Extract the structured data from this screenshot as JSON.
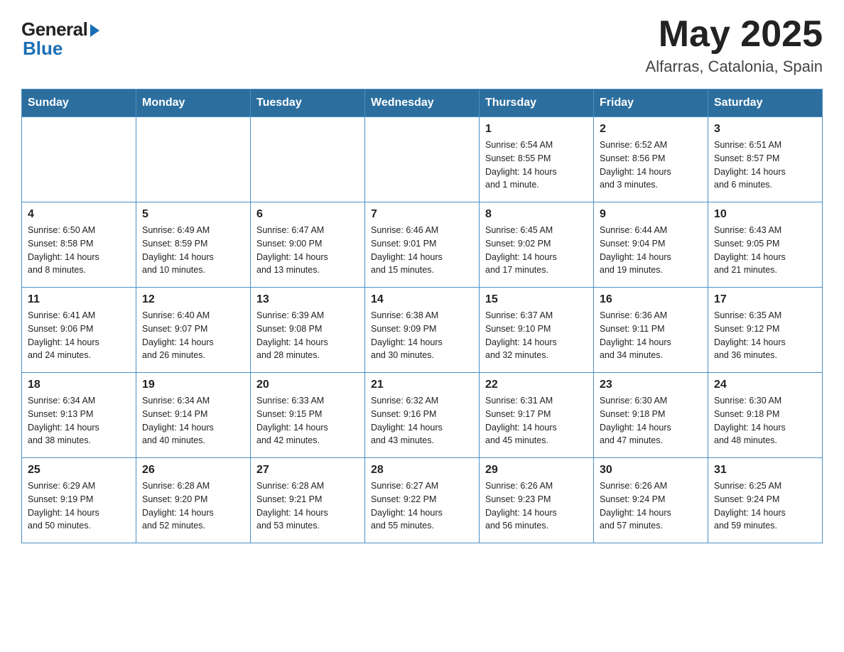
{
  "header": {
    "logo": {
      "general": "General",
      "blue": "Blue"
    },
    "title": "May 2025",
    "location": "Alfarras, Catalonia, Spain"
  },
  "weekdays": [
    "Sunday",
    "Monday",
    "Tuesday",
    "Wednesday",
    "Thursday",
    "Friday",
    "Saturday"
  ],
  "weeks": [
    [
      {
        "day": "",
        "info": ""
      },
      {
        "day": "",
        "info": ""
      },
      {
        "day": "",
        "info": ""
      },
      {
        "day": "",
        "info": ""
      },
      {
        "day": "1",
        "info": "Sunrise: 6:54 AM\nSunset: 8:55 PM\nDaylight: 14 hours\nand 1 minute."
      },
      {
        "day": "2",
        "info": "Sunrise: 6:52 AM\nSunset: 8:56 PM\nDaylight: 14 hours\nand 3 minutes."
      },
      {
        "day": "3",
        "info": "Sunrise: 6:51 AM\nSunset: 8:57 PM\nDaylight: 14 hours\nand 6 minutes."
      }
    ],
    [
      {
        "day": "4",
        "info": "Sunrise: 6:50 AM\nSunset: 8:58 PM\nDaylight: 14 hours\nand 8 minutes."
      },
      {
        "day": "5",
        "info": "Sunrise: 6:49 AM\nSunset: 8:59 PM\nDaylight: 14 hours\nand 10 minutes."
      },
      {
        "day": "6",
        "info": "Sunrise: 6:47 AM\nSunset: 9:00 PM\nDaylight: 14 hours\nand 13 minutes."
      },
      {
        "day": "7",
        "info": "Sunrise: 6:46 AM\nSunset: 9:01 PM\nDaylight: 14 hours\nand 15 minutes."
      },
      {
        "day": "8",
        "info": "Sunrise: 6:45 AM\nSunset: 9:02 PM\nDaylight: 14 hours\nand 17 minutes."
      },
      {
        "day": "9",
        "info": "Sunrise: 6:44 AM\nSunset: 9:04 PM\nDaylight: 14 hours\nand 19 minutes."
      },
      {
        "day": "10",
        "info": "Sunrise: 6:43 AM\nSunset: 9:05 PM\nDaylight: 14 hours\nand 21 minutes."
      }
    ],
    [
      {
        "day": "11",
        "info": "Sunrise: 6:41 AM\nSunset: 9:06 PM\nDaylight: 14 hours\nand 24 minutes."
      },
      {
        "day": "12",
        "info": "Sunrise: 6:40 AM\nSunset: 9:07 PM\nDaylight: 14 hours\nand 26 minutes."
      },
      {
        "day": "13",
        "info": "Sunrise: 6:39 AM\nSunset: 9:08 PM\nDaylight: 14 hours\nand 28 minutes."
      },
      {
        "day": "14",
        "info": "Sunrise: 6:38 AM\nSunset: 9:09 PM\nDaylight: 14 hours\nand 30 minutes."
      },
      {
        "day": "15",
        "info": "Sunrise: 6:37 AM\nSunset: 9:10 PM\nDaylight: 14 hours\nand 32 minutes."
      },
      {
        "day": "16",
        "info": "Sunrise: 6:36 AM\nSunset: 9:11 PM\nDaylight: 14 hours\nand 34 minutes."
      },
      {
        "day": "17",
        "info": "Sunrise: 6:35 AM\nSunset: 9:12 PM\nDaylight: 14 hours\nand 36 minutes."
      }
    ],
    [
      {
        "day": "18",
        "info": "Sunrise: 6:34 AM\nSunset: 9:13 PM\nDaylight: 14 hours\nand 38 minutes."
      },
      {
        "day": "19",
        "info": "Sunrise: 6:34 AM\nSunset: 9:14 PM\nDaylight: 14 hours\nand 40 minutes."
      },
      {
        "day": "20",
        "info": "Sunrise: 6:33 AM\nSunset: 9:15 PM\nDaylight: 14 hours\nand 42 minutes."
      },
      {
        "day": "21",
        "info": "Sunrise: 6:32 AM\nSunset: 9:16 PM\nDaylight: 14 hours\nand 43 minutes."
      },
      {
        "day": "22",
        "info": "Sunrise: 6:31 AM\nSunset: 9:17 PM\nDaylight: 14 hours\nand 45 minutes."
      },
      {
        "day": "23",
        "info": "Sunrise: 6:30 AM\nSunset: 9:18 PM\nDaylight: 14 hours\nand 47 minutes."
      },
      {
        "day": "24",
        "info": "Sunrise: 6:30 AM\nSunset: 9:18 PM\nDaylight: 14 hours\nand 48 minutes."
      }
    ],
    [
      {
        "day": "25",
        "info": "Sunrise: 6:29 AM\nSunset: 9:19 PM\nDaylight: 14 hours\nand 50 minutes."
      },
      {
        "day": "26",
        "info": "Sunrise: 6:28 AM\nSunset: 9:20 PM\nDaylight: 14 hours\nand 52 minutes."
      },
      {
        "day": "27",
        "info": "Sunrise: 6:28 AM\nSunset: 9:21 PM\nDaylight: 14 hours\nand 53 minutes."
      },
      {
        "day": "28",
        "info": "Sunrise: 6:27 AM\nSunset: 9:22 PM\nDaylight: 14 hours\nand 55 minutes."
      },
      {
        "day": "29",
        "info": "Sunrise: 6:26 AM\nSunset: 9:23 PM\nDaylight: 14 hours\nand 56 minutes."
      },
      {
        "day": "30",
        "info": "Sunrise: 6:26 AM\nSunset: 9:24 PM\nDaylight: 14 hours\nand 57 minutes."
      },
      {
        "day": "31",
        "info": "Sunrise: 6:25 AM\nSunset: 9:24 PM\nDaylight: 14 hours\nand 59 minutes."
      }
    ]
  ]
}
